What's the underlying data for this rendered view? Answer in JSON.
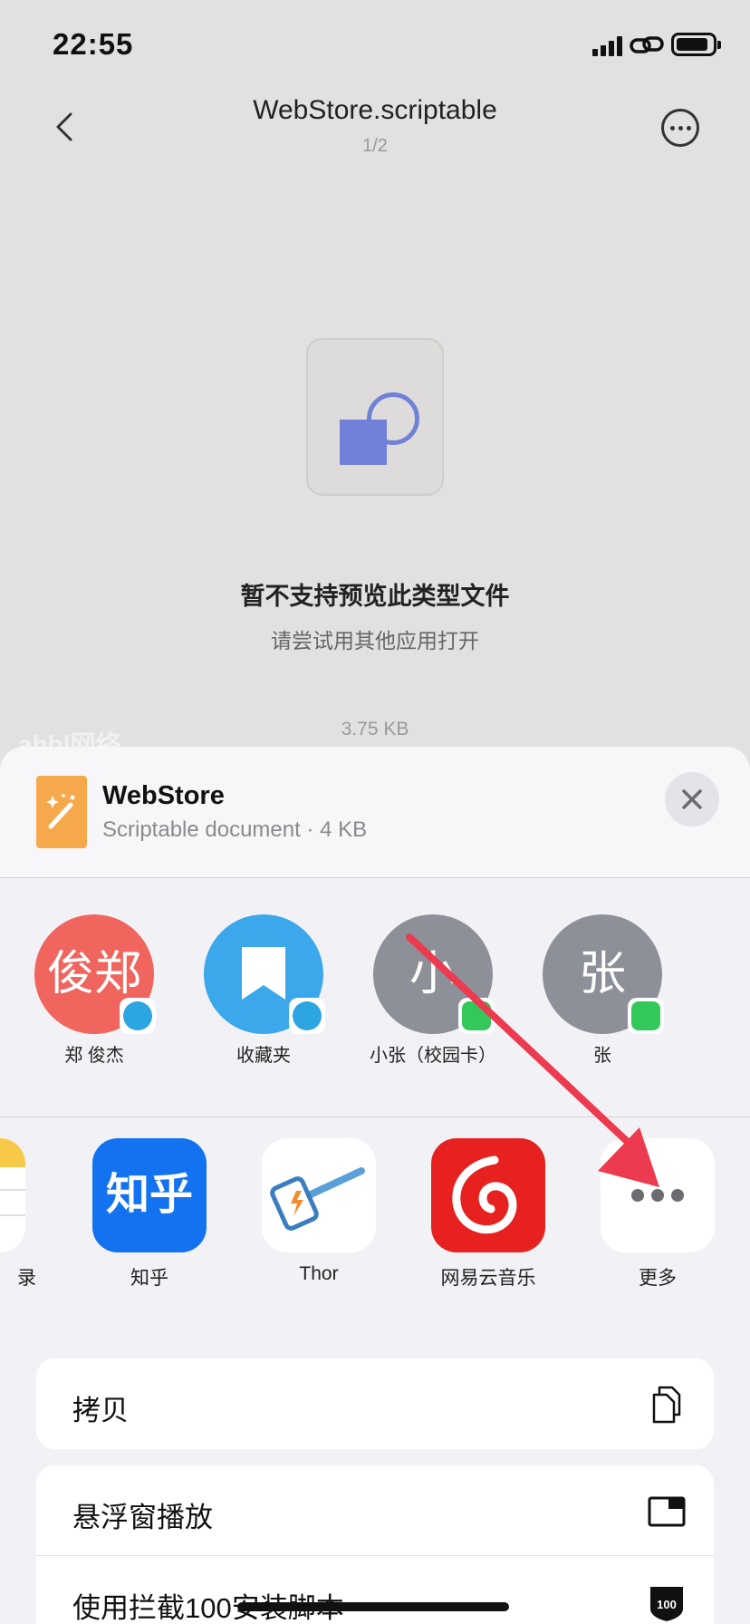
{
  "status_bar": {
    "time": "22:55"
  },
  "nav": {
    "title": "WebStore.scriptable",
    "page_indicator": "1/2"
  },
  "preview": {
    "message": "暂不支持预览此类型文件",
    "hint": "请尝试用其他应用打开",
    "file_size": "3.75 KB",
    "watermark": "ahbl网络"
  },
  "share_sheet": {
    "doc_name": "WebStore",
    "doc_meta": "Scriptable document · 4 KB",
    "people": [
      {
        "name": "郑 俊杰",
        "avatar_text": "俊郑",
        "avatar_color": "#f0665e",
        "badge": "telegram-icon"
      },
      {
        "name": "收藏夹",
        "avatar_text": "",
        "avatar_color": "#3aa8ea",
        "badge": "telegram-icon"
      },
      {
        "name": "小张（校园卡）",
        "avatar_text": "小",
        "avatar_color": "#8e9099",
        "badge": "messages-icon"
      },
      {
        "name": "张",
        "avatar_text": "张",
        "avatar_color": "#8e9099",
        "badge": "messages-icon"
      }
    ],
    "apps": [
      {
        "name": "录",
        "icon": "notes-icon"
      },
      {
        "name": "知乎",
        "icon": "zhihu-icon",
        "tile_text": "知乎",
        "color": "#1372ef"
      },
      {
        "name": "Thor",
        "icon": "thor-icon",
        "color": "#ffffff"
      },
      {
        "name": "网易云音乐",
        "icon": "netease-music-icon",
        "color": "#e6211f"
      },
      {
        "name": "更多",
        "icon": "more-icon",
        "color": "#ffffff"
      }
    ],
    "actions": [
      {
        "label": "拷贝",
        "icon": "copy-icon"
      },
      {
        "label": "悬浮窗播放",
        "icon": "picture-in-picture-icon"
      },
      {
        "label": "使用拦截100安装脚本",
        "icon": "lanjie100-icon"
      }
    ]
  },
  "colors": {
    "accent_arrow": "#ec3a4f",
    "sheet_bg": "#f2f2f6"
  }
}
